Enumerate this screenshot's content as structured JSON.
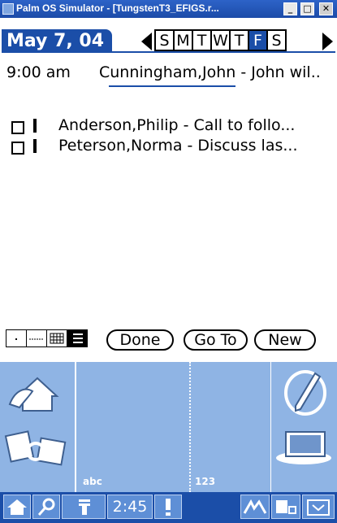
{
  "window": {
    "title": "Palm OS Simulator - [TungstenT3_EFIGS.r...",
    "min_label": "_",
    "max_label": "□",
    "close_label": "✕"
  },
  "header": {
    "date": "May 7, 04",
    "days": [
      "S",
      "M",
      "T",
      "W",
      "T",
      "F",
      "S"
    ],
    "selected_day": "F"
  },
  "appointment": {
    "time": "9:00 am",
    "text": "Cunningham,John - John wil.."
  },
  "todos": [
    {
      "text": "Anderson,Philip - Call to follo...",
      "priority": "1"
    },
    {
      "text": "Peterson,Norma - Discuss las..."
    }
  ],
  "buttons": {
    "done": "Done",
    "goto": "Go To",
    "new": "New"
  },
  "graffiti": {
    "left_label": "abc",
    "right_label": "123"
  },
  "status": {
    "time": "2:45"
  },
  "colors": {
    "accent": "#1b4ea8",
    "graffiti": "#8fb4e4"
  }
}
